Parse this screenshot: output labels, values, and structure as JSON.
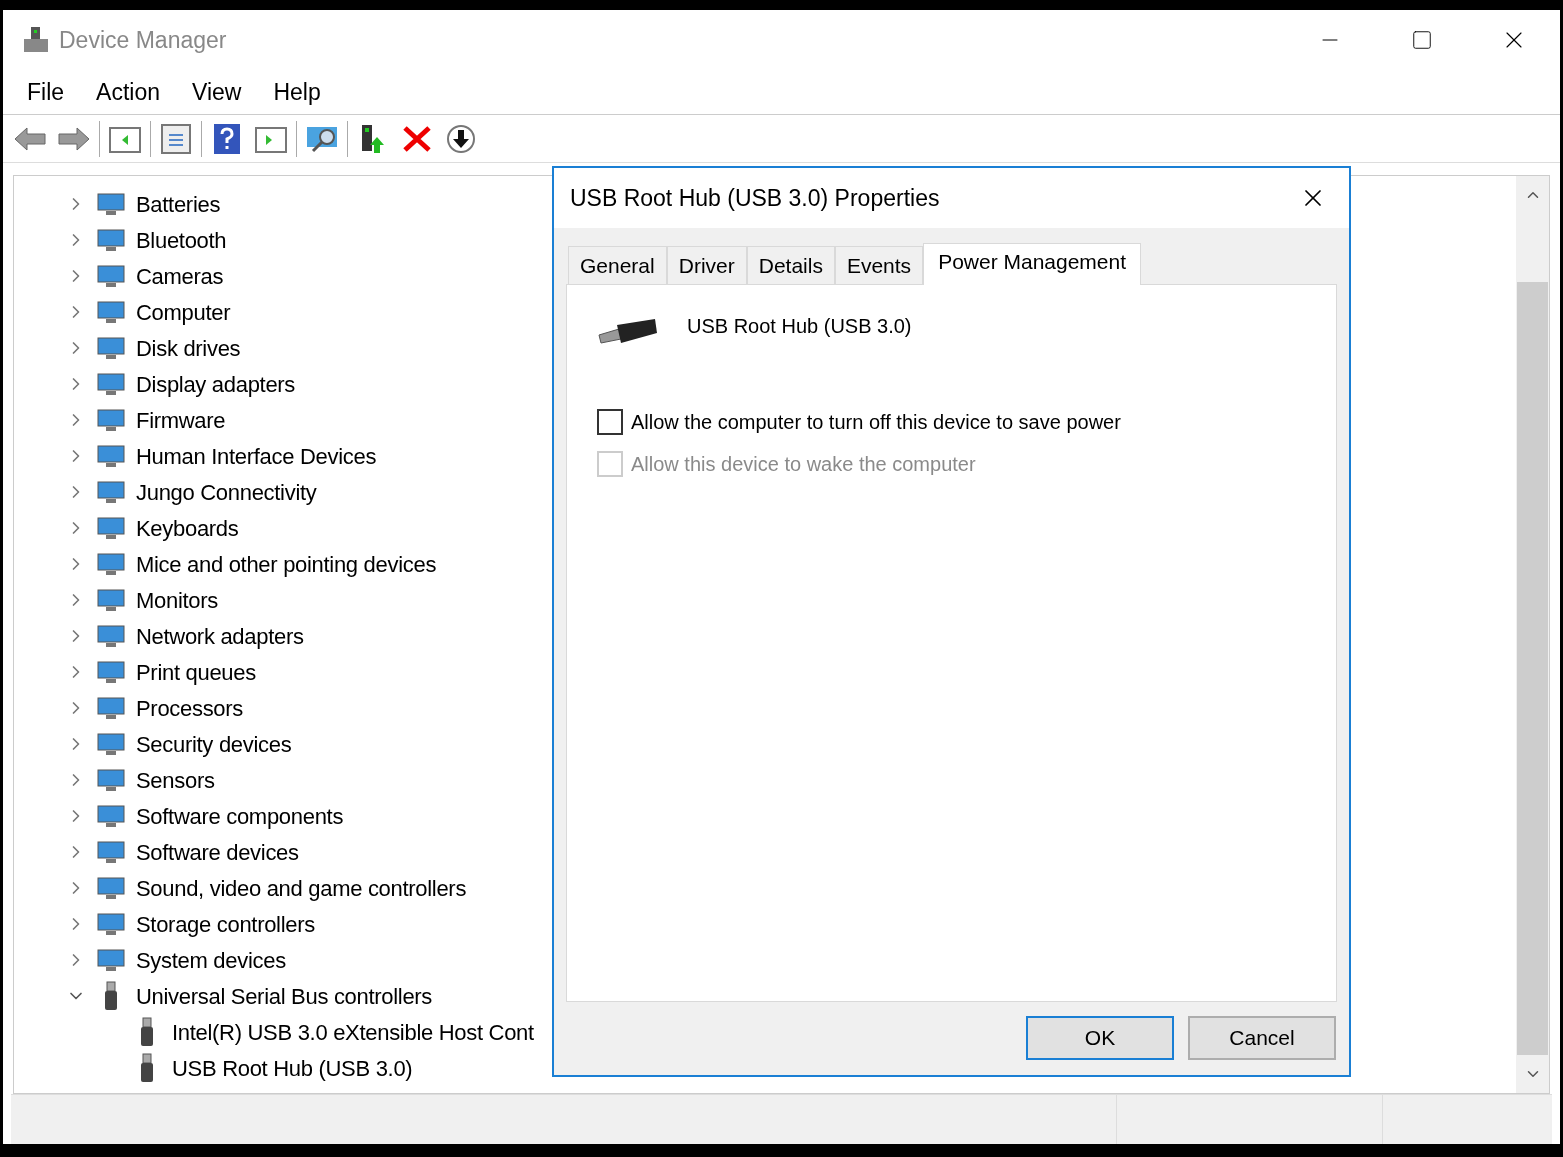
{
  "window": {
    "title": "Device Manager"
  },
  "menu": [
    "File",
    "Action",
    "View",
    "Help"
  ],
  "tree": [
    {
      "label": "Batteries",
      "expanded": false
    },
    {
      "label": "Bluetooth",
      "expanded": false
    },
    {
      "label": "Cameras",
      "expanded": false
    },
    {
      "label": "Computer",
      "expanded": false
    },
    {
      "label": "Disk drives",
      "expanded": false
    },
    {
      "label": "Display adapters",
      "expanded": false
    },
    {
      "label": "Firmware",
      "expanded": false
    },
    {
      "label": "Human Interface Devices",
      "expanded": false
    },
    {
      "label": "Jungo Connectivity",
      "expanded": false
    },
    {
      "label": "Keyboards",
      "expanded": false
    },
    {
      "label": "Mice and other pointing devices",
      "expanded": false
    },
    {
      "label": "Monitors",
      "expanded": false
    },
    {
      "label": "Network adapters",
      "expanded": false
    },
    {
      "label": "Print queues",
      "expanded": false
    },
    {
      "label": "Processors",
      "expanded": false
    },
    {
      "label": "Security devices",
      "expanded": false
    },
    {
      "label": "Sensors",
      "expanded": false
    },
    {
      "label": "Software components",
      "expanded": false
    },
    {
      "label": "Software devices",
      "expanded": false
    },
    {
      "label": "Sound, video and game controllers",
      "expanded": false
    },
    {
      "label": "Storage controllers",
      "expanded": false
    },
    {
      "label": "System devices",
      "expanded": false
    },
    {
      "label": "Universal Serial Bus controllers",
      "expanded": true,
      "children": [
        {
          "label": "Intel(R) USB 3.0 eXtensible Host Cont"
        },
        {
          "label": "USB Root Hub (USB 3.0)"
        }
      ]
    }
  ],
  "dialog": {
    "title": "USB Root Hub (USB 3.0) Properties",
    "tabs": [
      {
        "label": "General",
        "selected": false
      },
      {
        "label": "Driver",
        "selected": false
      },
      {
        "label": "Details",
        "selected": false
      },
      {
        "label": "Events",
        "selected": false
      },
      {
        "label": "Power Management",
        "selected": true
      }
    ],
    "device_name": "USB Root Hub (USB 3.0)",
    "options": [
      {
        "label": "Allow the computer to turn off this device to save power",
        "checked": false,
        "disabled": false
      },
      {
        "label": "Allow this device to wake the computer",
        "checked": false,
        "disabled": true
      }
    ],
    "buttons": [
      {
        "label": "OK",
        "default": true
      },
      {
        "label": "Cancel",
        "default": false
      }
    ]
  }
}
